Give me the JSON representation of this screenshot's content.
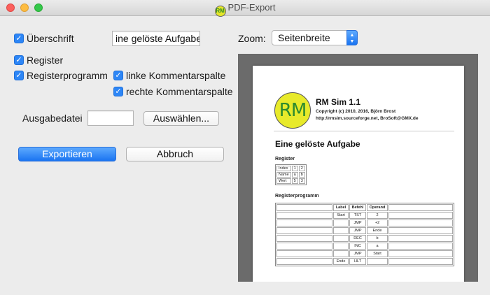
{
  "window": {
    "title": "PDF-Export",
    "logo_text": "RM"
  },
  "options": {
    "heading": {
      "label": "Überschrift",
      "checked": true,
      "value": "ine gelöste Aufgabe"
    },
    "register": {
      "label": "Register",
      "checked": true
    },
    "register_program": {
      "label": "Registerprogramm",
      "checked": true
    },
    "left_comment": {
      "label": "linke Kommentarspalte",
      "checked": true
    },
    "right_comment": {
      "label": "rechte Kommentarspalte",
      "checked": true
    }
  },
  "output": {
    "label": "Ausgabedatei",
    "value": "",
    "choose_label": "Auswählen..."
  },
  "actions": {
    "export_label": "Exportieren",
    "cancel_label": "Abbruch"
  },
  "zoom": {
    "label": "Zoom:",
    "value": "Seitenbreite"
  },
  "preview": {
    "logo_text": "RM",
    "app_title": "RM Sim 1.1",
    "copyright": "Copyright (c) 2010, 2016, Björn Brost",
    "contact": "http://rmsim.sourceforge.net, BroSoft@GMX.de",
    "doc_title": "Eine gelöste Aufgabe",
    "register_heading": "Register",
    "register_table": [
      [
        "Index",
        "1",
        "2"
      ],
      [
        "Name",
        "a",
        "b"
      ],
      [
        "Wert",
        "5",
        "3"
      ]
    ],
    "program_heading": "Registerprogramm",
    "program_headers": [
      "",
      "Label",
      "Befehl",
      "Operand",
      ""
    ],
    "program_rows": [
      [
        "",
        "Start",
        "TST",
        "2",
        ""
      ],
      [
        "",
        "",
        "JMP",
        "+2",
        ""
      ],
      [
        "",
        "",
        "JMP",
        "Ende",
        ""
      ],
      [
        "",
        "",
        "DEC",
        "b",
        ""
      ],
      [
        "",
        "",
        "INC",
        "a",
        ""
      ],
      [
        "",
        "",
        "JMP",
        "Start",
        ""
      ],
      [
        "",
        "Ende",
        "HLT",
        "",
        ""
      ]
    ]
  }
}
